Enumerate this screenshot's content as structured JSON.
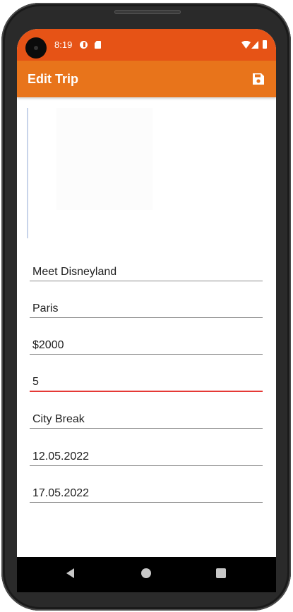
{
  "status_bar": {
    "time": "8:19",
    "icons": [
      "data-saver-icon",
      "sd-card-icon",
      "wifi-icon",
      "signal-icon",
      "battery-icon"
    ]
  },
  "app_bar": {
    "title": "Edit Trip",
    "save_icon": "save-icon"
  },
  "form": {
    "name": "Meet Disneyland",
    "destination": "Paris",
    "budget": "$2000",
    "days": "5",
    "type": "City Break",
    "start_date": "12.05.2022",
    "end_date": "17.05.2022"
  },
  "nav": {
    "icons": [
      "back-icon",
      "home-icon",
      "recents-icon"
    ]
  },
  "colors": {
    "status_bar": "#e65316",
    "app_bar": "#e8741b",
    "active_underline": "#e53935",
    "underline": "#8a8a8a"
  }
}
